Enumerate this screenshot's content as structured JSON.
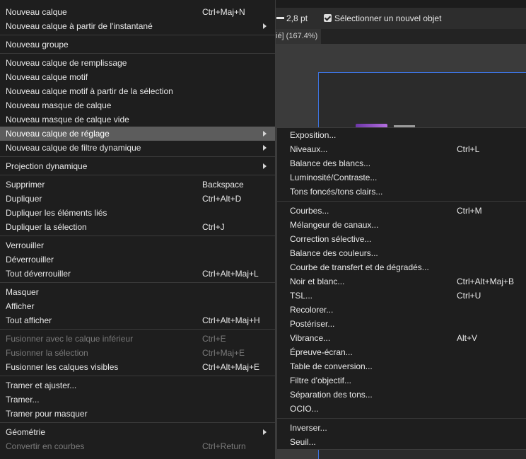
{
  "colors": {
    "menu_bg": "#1e1e1e",
    "menu_text": "#e8e8e8",
    "menu_text_disabled": "#7a7a7a",
    "menu_highlight": "#5c5c5c",
    "menu_separator": "#3a3a3a",
    "canvas_bg": "#3b3b3b",
    "document_bg": "#2b2b2b",
    "document_border": "#3d72dc",
    "toolbar_bg": "#2d2d2d"
  },
  "toolbar": {
    "stroke_icon": "stroke-width-icon",
    "stroke_width": "2,8 pt",
    "select_new_object": {
      "label": "Sélectionner un nouvel objet",
      "checked": true
    }
  },
  "document_tab": {
    "title": "ié] (167.4%)"
  },
  "main_menu": {
    "submenu_icon": "chevron-right-icon",
    "items": [
      {
        "label": "Nouveau calque",
        "shortcut": "Ctrl+Maj+N"
      },
      {
        "label": "Nouveau calque à partir de l'instantané",
        "has_submenu": true
      },
      {
        "label": "Nouveau groupe"
      },
      {
        "label": "Nouveau calque de remplissage"
      },
      {
        "label": "Nouveau calque motif"
      },
      {
        "label": "Nouveau calque motif à partir de la sélection"
      },
      {
        "label": "Nouveau masque de calque"
      },
      {
        "label": "Nouveau masque de calque vide"
      },
      {
        "label": "Nouveau calque de réglage",
        "has_submenu": true,
        "highlighted": true
      },
      {
        "label": "Nouveau calque de filtre dynamique",
        "has_submenu": true
      },
      {
        "label": "Projection dynamique",
        "has_submenu": true
      },
      {
        "label": "Supprimer",
        "shortcut": "Backspace"
      },
      {
        "label": "Dupliquer",
        "shortcut": "Ctrl+Alt+D"
      },
      {
        "label": "Dupliquer les éléments liés"
      },
      {
        "label": "Dupliquer la sélection",
        "shortcut": "Ctrl+J"
      },
      {
        "label": "Verrouiller"
      },
      {
        "label": "Déverrouiller"
      },
      {
        "label": "Tout déverrouiller",
        "shortcut": "Ctrl+Alt+Maj+L"
      },
      {
        "label": "Masquer"
      },
      {
        "label": "Afficher"
      },
      {
        "label": "Tout afficher",
        "shortcut": "Ctrl+Alt+Maj+H"
      },
      {
        "label": "Fusionner avec le calque inférieur",
        "shortcut": "Ctrl+E",
        "disabled": true
      },
      {
        "label": "Fusionner la sélection",
        "shortcut": "Ctrl+Maj+E",
        "disabled": true
      },
      {
        "label": "Fusionner les calques visibles",
        "shortcut": "Ctrl+Alt+Maj+E"
      },
      {
        "label": "Tramer et ajuster..."
      },
      {
        "label": "Tramer..."
      },
      {
        "label": "Tramer pour masquer"
      },
      {
        "label": "Géométrie",
        "has_submenu": true
      },
      {
        "label": "Convertir en courbes",
        "shortcut": "Ctrl+Return",
        "disabled": true
      }
    ]
  },
  "adjustment_submenu": {
    "items": [
      {
        "label": "Exposition..."
      },
      {
        "label": "Niveaux...",
        "shortcut": "Ctrl+L"
      },
      {
        "label": "Balance des blancs..."
      },
      {
        "label": "Luminosité/Contraste..."
      },
      {
        "label": "Tons foncés/tons clairs..."
      },
      {
        "label": "Courbes...",
        "shortcut": "Ctrl+M"
      },
      {
        "label": "Mélangeur de canaux..."
      },
      {
        "label": "Correction sélective..."
      },
      {
        "label": "Balance des couleurs..."
      },
      {
        "label": "Courbe de transfert et de dégradés..."
      },
      {
        "label": "Noir et blanc...",
        "shortcut": "Ctrl+Alt+Maj+B"
      },
      {
        "label": "TSL...",
        "shortcut": "Ctrl+U"
      },
      {
        "label": "Recolorer..."
      },
      {
        "label": "Postériser..."
      },
      {
        "label": "Vibrance...",
        "shortcut": "Alt+V"
      },
      {
        "label": "Épreuve-écran..."
      },
      {
        "label": "Table de conversion..."
      },
      {
        "label": "Filtre d'objectif..."
      },
      {
        "label": "Séparation des tons..."
      },
      {
        "label": "OCIO..."
      },
      {
        "label": "Inverser..."
      },
      {
        "label": "Seuil..."
      }
    ]
  }
}
